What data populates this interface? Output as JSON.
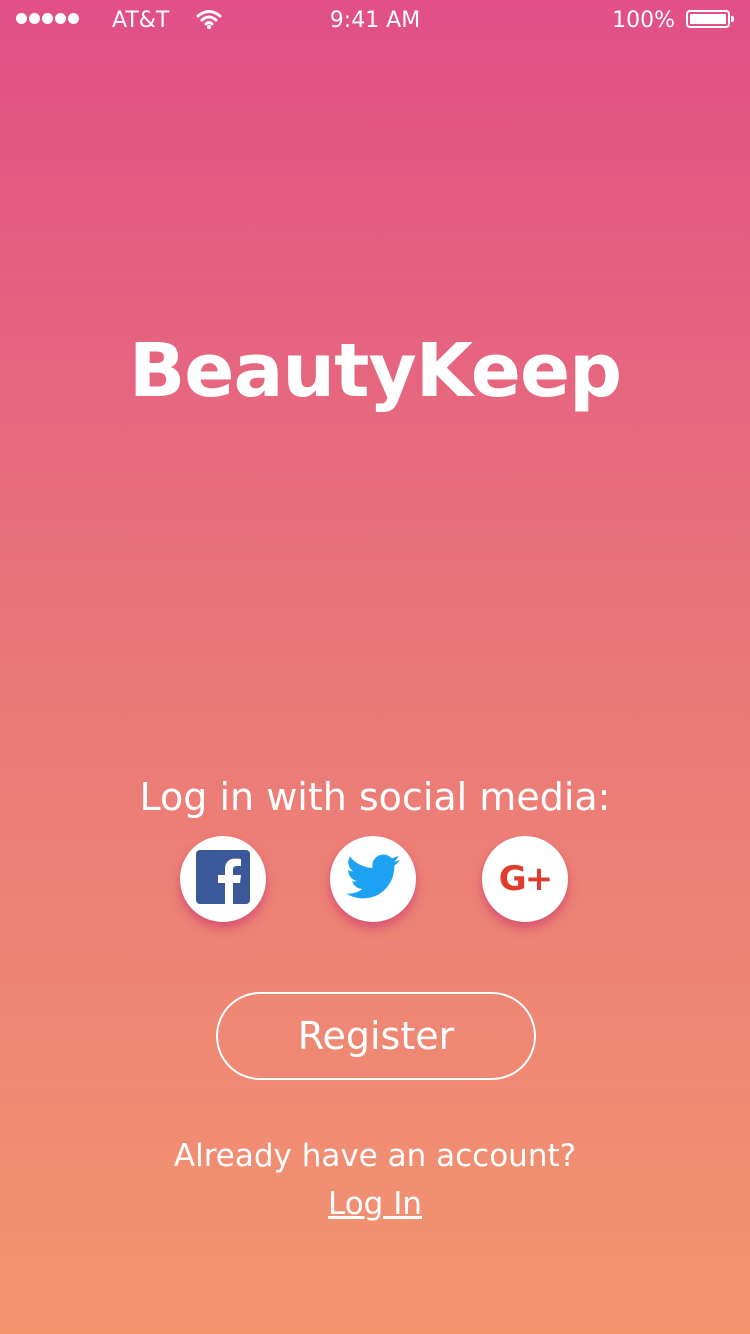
{
  "status_bar": {
    "carrier": "AT&T",
    "time": "9:41 AM",
    "battery": "100%",
    "icons": [
      "signal-dots-icon",
      "wifi-icon",
      "battery-icon"
    ]
  },
  "app": {
    "title": "BeautyKeep"
  },
  "social": {
    "label": "Log in with social media:",
    "buttons": [
      {
        "name": "facebook",
        "icon": "facebook-icon",
        "color": "#3b5998"
      },
      {
        "name": "twitter",
        "icon": "twitter-icon",
        "color": "#1da1f2"
      },
      {
        "name": "google-plus",
        "icon": "google-plus-icon",
        "color": "#e03b2f",
        "glyph": "G+"
      }
    ]
  },
  "actions": {
    "register_label": "Register",
    "already_text": "Already have an account?",
    "login_label": "Log In"
  },
  "colors": {
    "gradient_top": "#e14f86",
    "gradient_bottom": "#f2956f"
  }
}
